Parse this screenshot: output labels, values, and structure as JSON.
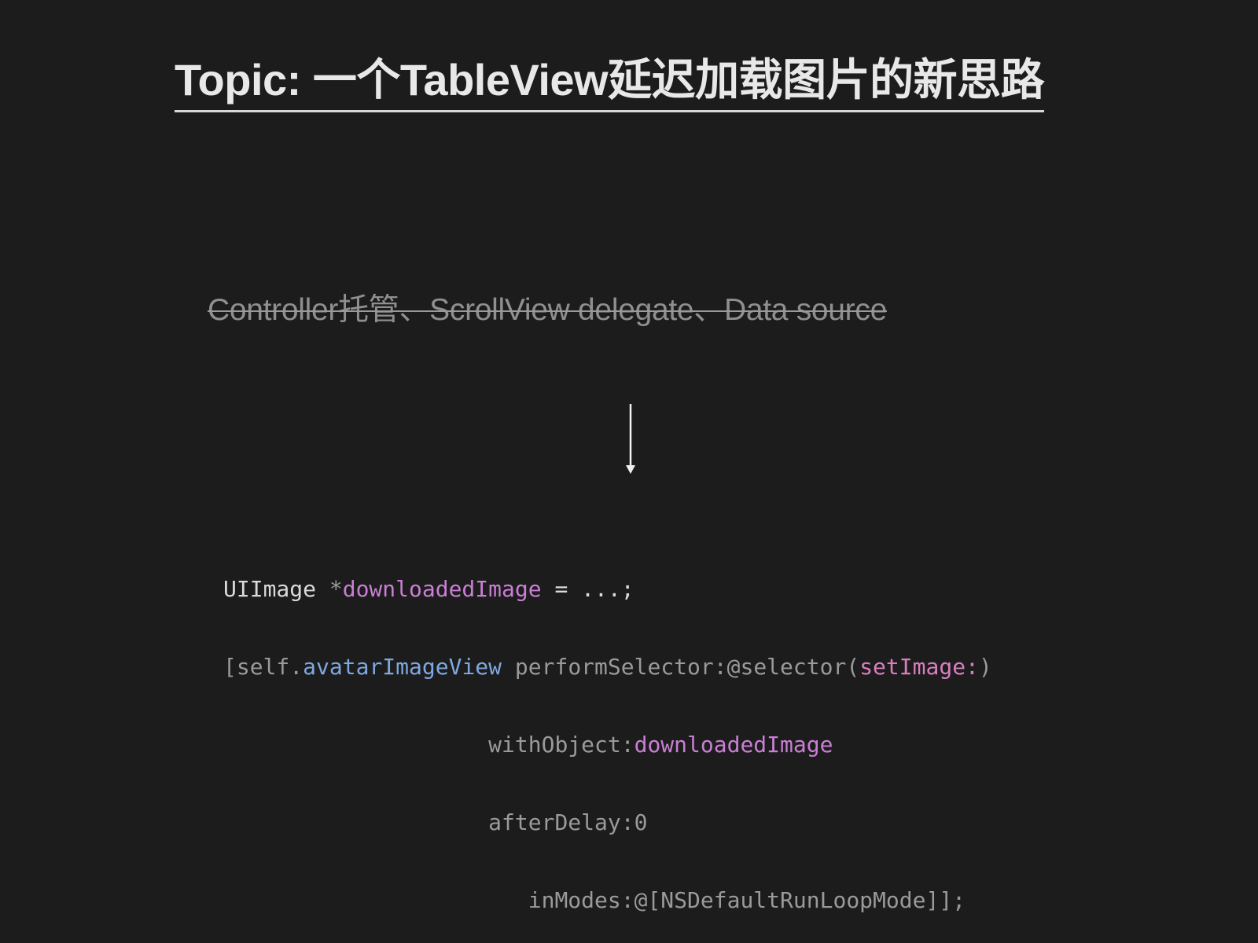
{
  "slide": {
    "title": "Topic: 一个TableView延迟加载图片的新思路",
    "struck_text": "Controller托管、ScrollView delegate、Data source"
  },
  "code": {
    "line1": {
      "type": "UIImage ",
      "star": "*",
      "var": "downloadedImage",
      "rest": " = ...;"
    },
    "line2": {
      "open": "[self.",
      "prop": "avatarImageView",
      "method": " performSelector:",
      "at_selector": "@selector(",
      "sel": "setImage:",
      "close": ")"
    },
    "line3": {
      "indent": "                    ",
      "label": "withObject:",
      "var": "downloadedImage"
    },
    "line4": {
      "indent": "                    ",
      "label": "afterDelay:",
      "num": "0"
    },
    "line5": {
      "indent": "                       ",
      "label": "inModes:",
      "value": "@[NSDefaultRunLoopMode]",
      "end": "];"
    }
  },
  "colors": {
    "background": "#1c1c1c",
    "variable": "#c97fd4",
    "property": "#7fa8e0",
    "selector": "#d97fc0"
  },
  "icons": {
    "arrow": "arrow-down-icon"
  }
}
